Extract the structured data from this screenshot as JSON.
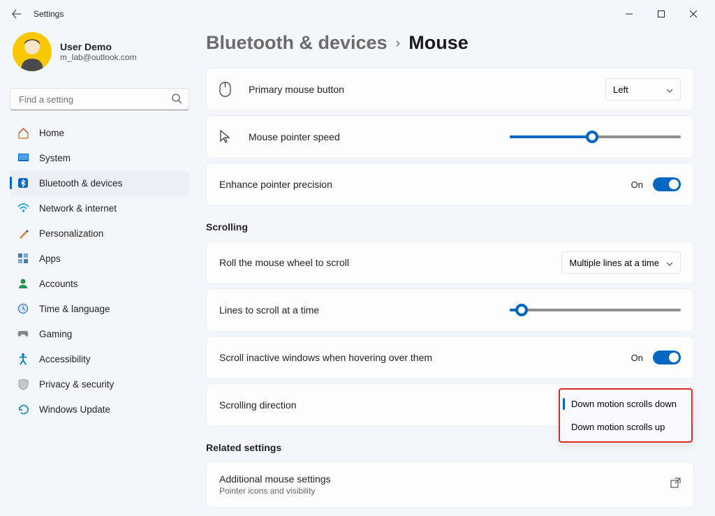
{
  "window": {
    "title": "Settings"
  },
  "user": {
    "name": "User Demo",
    "email": "m_lab@outlook.com"
  },
  "search": {
    "placeholder": "Find a setting"
  },
  "sidebar": {
    "items": [
      {
        "label": "Home"
      },
      {
        "label": "System"
      },
      {
        "label": "Bluetooth & devices"
      },
      {
        "label": "Network & internet"
      },
      {
        "label": "Personalization"
      },
      {
        "label": "Apps"
      },
      {
        "label": "Accounts"
      },
      {
        "label": "Time & language"
      },
      {
        "label": "Gaming"
      },
      {
        "label": "Accessibility"
      },
      {
        "label": "Privacy & security"
      },
      {
        "label": "Windows Update"
      }
    ]
  },
  "breadcrumb": {
    "parent": "Bluetooth & devices",
    "current": "Mouse"
  },
  "settings": {
    "primary_button": {
      "label": "Primary mouse button",
      "value": "Left"
    },
    "pointer_speed": {
      "label": "Mouse pointer speed",
      "percent": 48
    },
    "enhance_precision": {
      "label": "Enhance pointer precision",
      "state": "On"
    },
    "scroll_section": "Scrolling",
    "roll_wheel": {
      "label": "Roll the mouse wheel to scroll",
      "value": "Multiple lines at a time"
    },
    "lines_scroll": {
      "label": "Lines to scroll at a time",
      "percent": 7
    },
    "inactive_windows": {
      "label": "Scroll inactive windows when hovering over them",
      "state": "On"
    },
    "scroll_direction": {
      "label": "Scrolling direction",
      "options": [
        "Down motion scrolls down",
        "Down motion scrolls up"
      ]
    },
    "related_section": "Related settings",
    "additional": {
      "label": "Additional mouse settings",
      "sub": "Pointer icons and visibility"
    }
  }
}
